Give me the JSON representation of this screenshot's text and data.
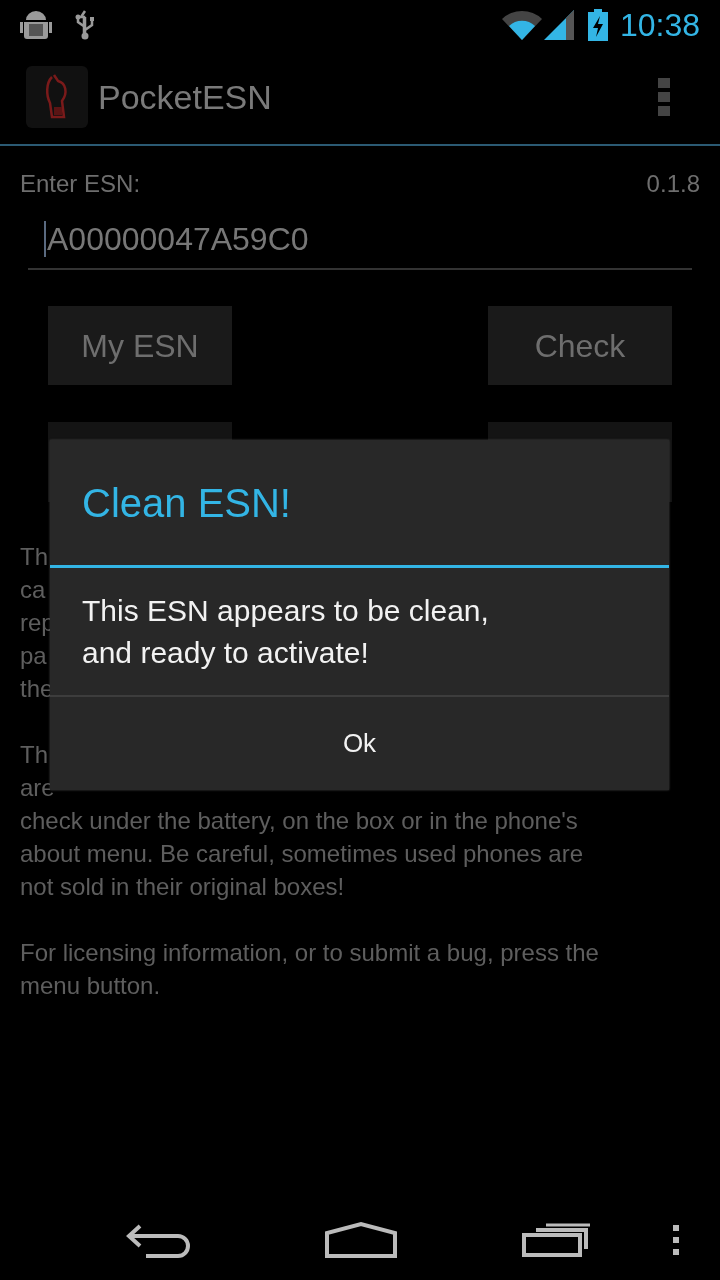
{
  "status_bar": {
    "time": "10:38"
  },
  "action_bar": {
    "title": "PocketESN"
  },
  "form": {
    "label": "Enter ESN:",
    "version": "0.1.8",
    "esn_value": "A00000047A59C0",
    "buttons": [
      "My ESN",
      "Check"
    ]
  },
  "background_text": {
    "paragraph_1_lines": [
      "Th",
      "ca",
      "rep",
      "pa",
      "the"
    ],
    "paragraph_2_lines": [
      "Th",
      "are",
      "check under the battery, on the box or in the phone's",
      "about menu. Be careful, sometimes used phones are",
      "not sold in their original boxes!"
    ],
    "paragraph_3": "For licensing information, or to submit a bug, press the menu button."
  },
  "dialog": {
    "title": "Clean ESN!",
    "message": "This ESN appears to be clean, and ready to activate!",
    "button": "Ok"
  }
}
